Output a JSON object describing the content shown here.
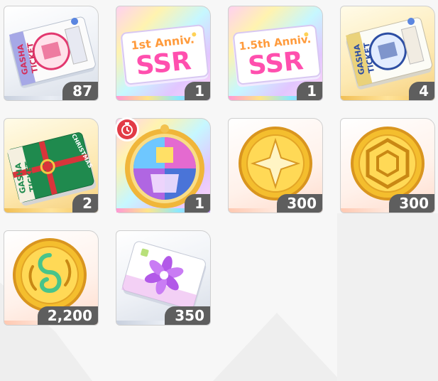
{
  "items": [
    {
      "name": "gasha-ticket-red",
      "count": "87",
      "text_lines": [
        "GASHA",
        "TICKET"
      ],
      "icon": "gasha-ticket-icon"
    },
    {
      "name": "ssr-1st-anniv-ticket",
      "count": "1",
      "anniv": "1st Anniv.",
      "grade": "SSR",
      "icon": "ssr-ticket-icon"
    },
    {
      "name": "ssr-1-5th-anniv-ticket",
      "count": "1",
      "anniv": "1.5th Anniv.",
      "grade": "SSR",
      "icon": "ssr-ticket-icon"
    },
    {
      "name": "gasha-ticket-blue",
      "count": "4",
      "text_lines": [
        "GASHA",
        "TICKET"
      ],
      "icon": "gasha-ticket-icon"
    },
    {
      "name": "christmas-gasha-ticket",
      "count": "2",
      "text_lines": [
        "GASHA",
        "TICKET"
      ],
      "ribbon": "CHRISTMAS",
      "icon": "christmas-ticket-icon"
    },
    {
      "name": "stained-glass-medal",
      "count": "1",
      "icon": "stained-glass-medal-icon",
      "timer": true
    },
    {
      "name": "sparkle-coin",
      "count": "300",
      "icon": "sparkle-coin-icon"
    },
    {
      "name": "hexagon-coin",
      "count": "300",
      "icon": "hexagon-coin-icon"
    },
    {
      "name": "swirl-coin",
      "count": "2,200",
      "icon": "swirl-coin-icon"
    },
    {
      "name": "flower-card",
      "count": "350",
      "icon": "flower-card-icon"
    }
  ],
  "colors": {
    "count_bg": "#5e5e5e",
    "count_text": "#ffffff",
    "timer_red": "#e23b46",
    "ssr_pink": "#ff4fae",
    "ssr_orange": "#ff9b3c"
  }
}
